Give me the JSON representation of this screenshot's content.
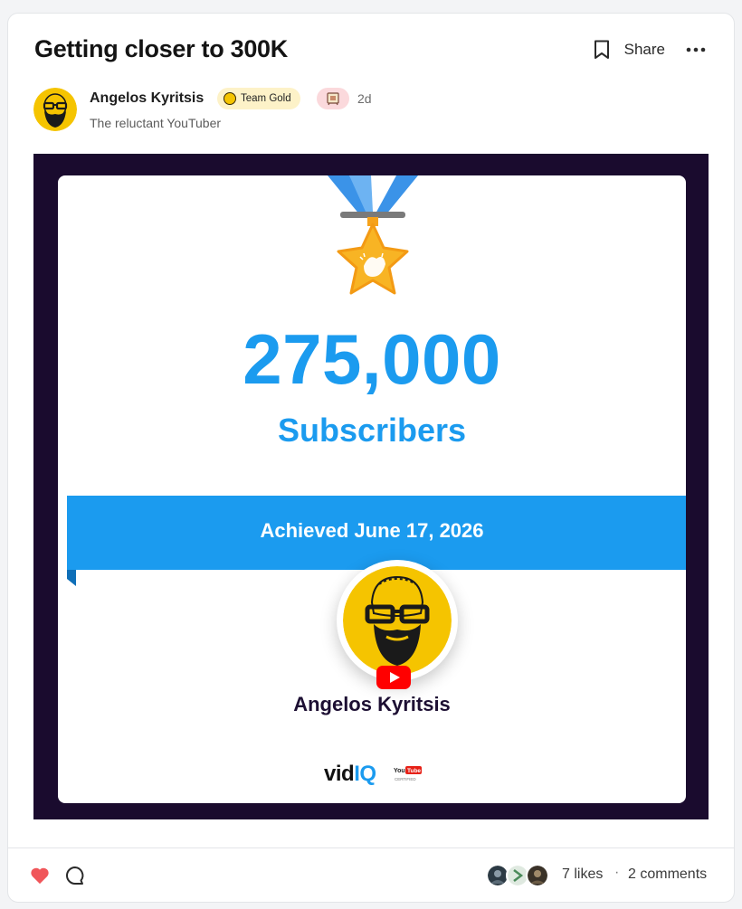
{
  "post": {
    "title": "Getting closer to 300K",
    "share_label": "Share",
    "time": "2d"
  },
  "author": {
    "name": "Angelos Kyritsis",
    "badge": "Team Gold",
    "tagline": "The reluctant YouTuber"
  },
  "milestone": {
    "count": "275,000",
    "unit": "Subscribers",
    "achieved": "Achieved June 17, 2026",
    "channel_name": "Angelos Kyritsis",
    "brand_vid": "vid",
    "brand_iq": "IQ",
    "brand_small": "YouTube",
    "brand_cert": "CERTIFIED"
  },
  "footer": {
    "likes": "7 likes",
    "separator": "·",
    "comments": "2 comments"
  },
  "colors": {
    "accent_blue": "#1b9bef",
    "frame_dark": "#1a0b2e",
    "avatar_yellow": "#f5c400",
    "heart_red": "#f0565a"
  },
  "icons": [
    "bookmark-icon",
    "more-icon",
    "coin-icon",
    "medal-icon",
    "youtube-icon",
    "heart-icon",
    "comment-icon"
  ]
}
